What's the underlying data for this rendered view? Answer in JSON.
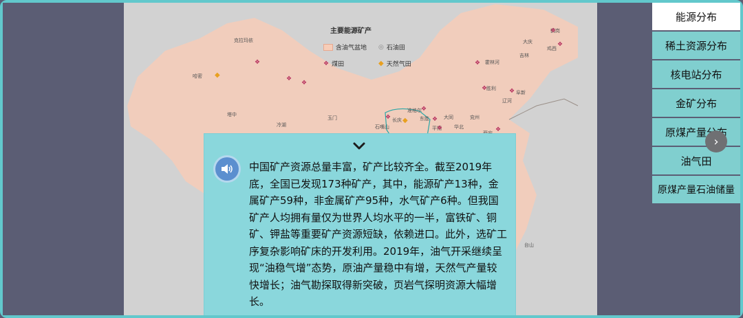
{
  "tabs": [
    {
      "label": "能源分布",
      "active": true
    },
    {
      "label": "稀土资源分布",
      "active": false
    },
    {
      "label": "核电站分布",
      "active": false
    },
    {
      "label": "金矿分布",
      "active": false
    },
    {
      "label": "原煤产量分布",
      "active": false
    },
    {
      "label": "油气田",
      "active": false
    },
    {
      "label": "原煤产量石油储量",
      "active": false
    }
  ],
  "legend": {
    "title": "主要能源矿产",
    "oil_basin": "含油气盆地",
    "oil_field": "石油田",
    "coal_field": "煤田",
    "gas_field": "天然气田"
  },
  "map_labels": {
    "karamay": "克拉玛依",
    "turpan_hami": "哈密",
    "tarim": "塔中",
    "lenghu": "冷湖",
    "yumen": "玉门",
    "changqing": "长庆",
    "datong": "大同",
    "daqing": "大庆",
    "jilin": "吉林",
    "liaohe": "辽河",
    "huolinhe": "霍林河",
    "shengli": "胜利",
    "pingshuo": "平朔",
    "shizuishan": "石嘴山",
    "north_china": "华北",
    "east": "兖州",
    "jungar": "准格尔",
    "yanbian": "鹤岗",
    "fushun": "阜新",
    "dongsheng": "东胜",
    "hegang": "鸡西",
    "xian": "西安",
    "taiwan": "台山"
  },
  "panel": {
    "text": "中国矿产资源总量丰富，矿产比较齐全。截至2019年底，全国已发现173种矿产，其中，能源矿产13种，金属矿产59种，非金属矿产95种，水气矿产6种。但我国矿产人均拥有量仅为世界人均水平的一半，富铁矿、铜矿、钾盐等重要矿产资源短缺，依赖进口。此外，选矿工序复杂影响矿床的开发利用。2019年，油气开采继续呈现“油稳气增”态势，原油产量稳中有增，天然气产量较快增长；油气勘探取得新突破，页岩气探明资源大幅增长。"
  },
  "icons": {
    "speaker": "speaker-icon",
    "collapse": "chevron-down-icon",
    "next": "chevron-right-icon"
  },
  "colors": {
    "frame": "#62c8cc",
    "tab": "#80cfcf",
    "panel": "#8ad7dc",
    "map_bg": "#d2d2d2",
    "land": "#f7cdb8",
    "coal": "#b83460",
    "gas": "#e8a020"
  }
}
